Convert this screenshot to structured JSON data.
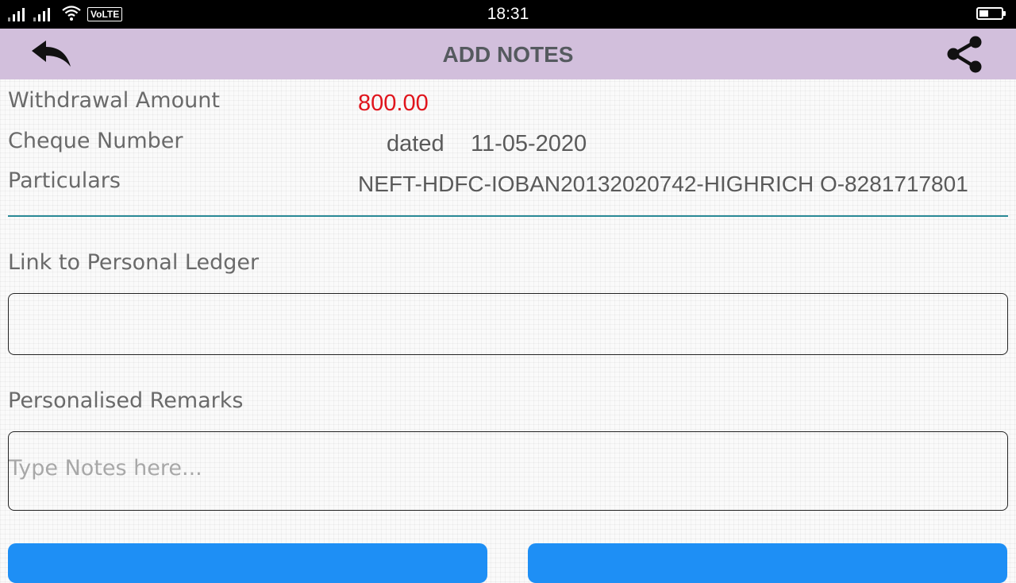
{
  "status_bar": {
    "time": "18:31",
    "network_badge": "VoLTE",
    "icons": [
      "signal-sim1-icon",
      "signal-sim2-icon",
      "wifi-icon",
      "battery-icon"
    ]
  },
  "app_bar": {
    "title": "ADD NOTES",
    "back_icon": "back-arrow-icon",
    "share_icon": "share-icon",
    "color": "#d2bfdc"
  },
  "transaction": {
    "withdrawal_label": "Withdrawal Amount",
    "withdrawal_value": "800.00",
    "cheque_label": "Cheque Number",
    "cheque_value": "",
    "dated_label": "dated",
    "dated_value": "11-05-2020",
    "particulars_label": "Particulars",
    "particulars_value": "NEFT-HDFC-IOBAN20132020742-HIGHRICH O-8281717801",
    "amount_color": "#e0141c"
  },
  "ledger": {
    "label": "Link to Personal Ledger",
    "value": ""
  },
  "remarks": {
    "label": "Personalised Remarks",
    "placeholder": "Type Notes here...",
    "value": ""
  },
  "buttons": {
    "left_label": "",
    "right_label": "",
    "color": "#1e8ff5"
  }
}
